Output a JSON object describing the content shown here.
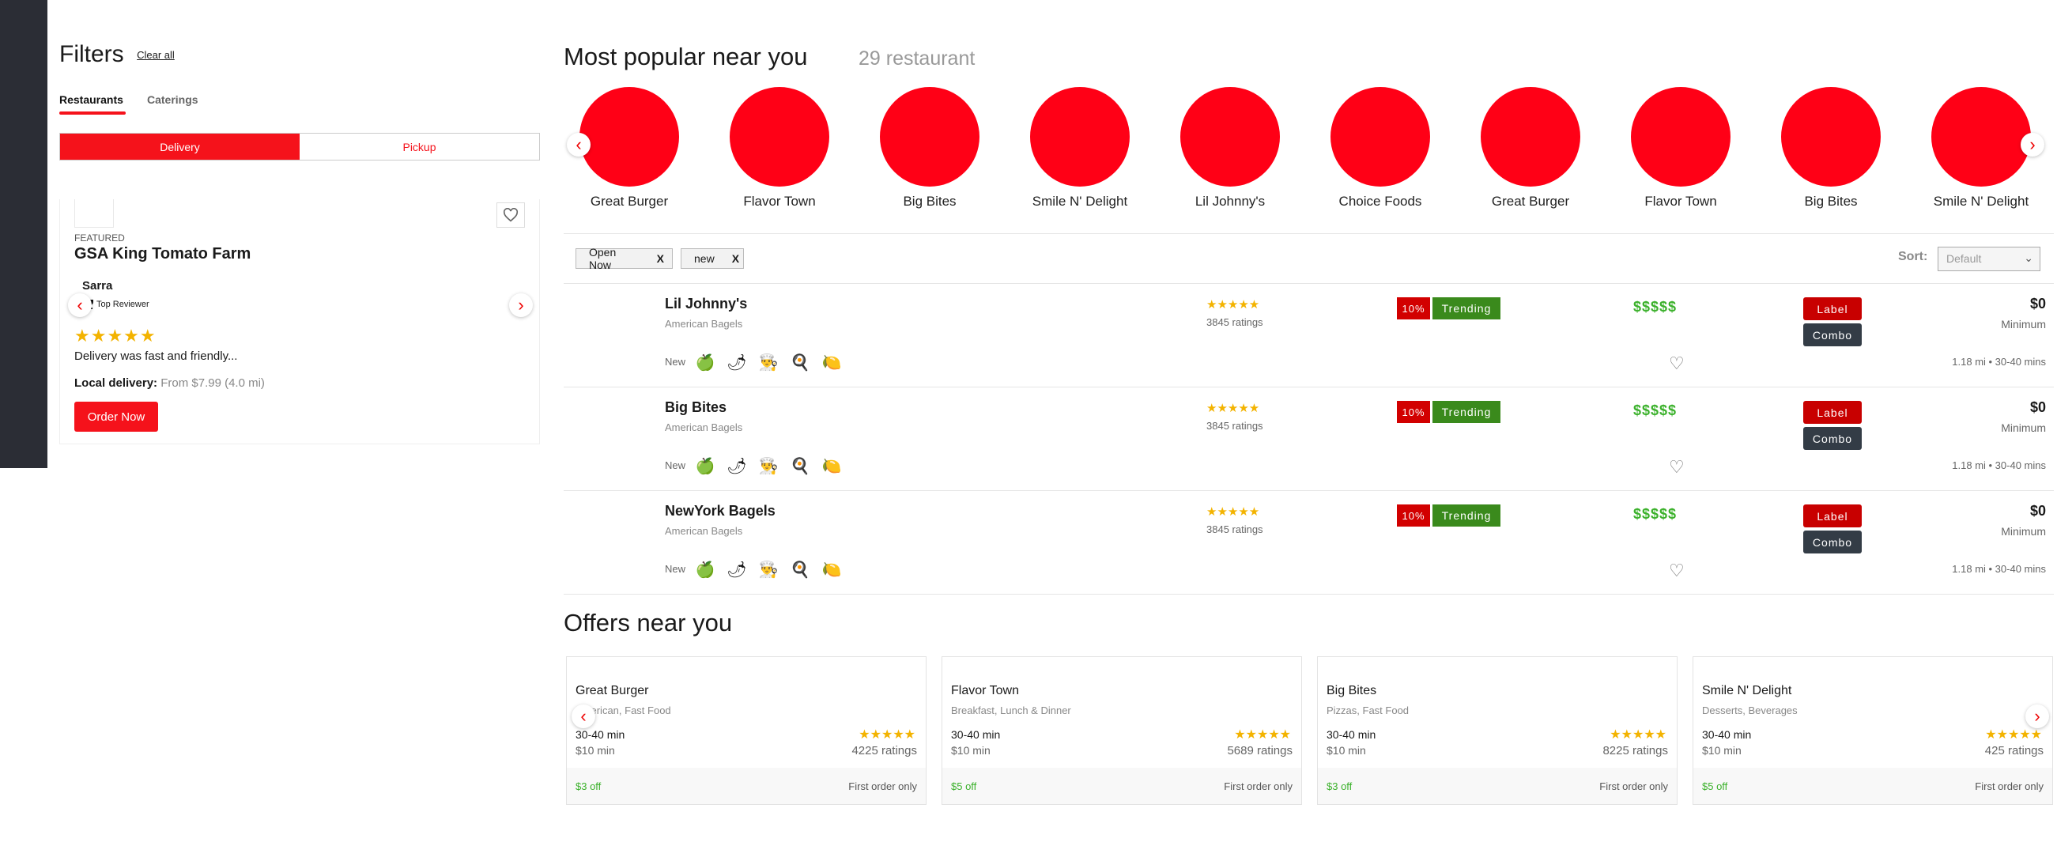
{
  "filters": {
    "title": "Filters",
    "clear": "Clear all",
    "tabs": [
      "Restaurants",
      "Caterings"
    ],
    "toggle": [
      "Delivery",
      "Pickup"
    ]
  },
  "review": {
    "featured": "FEATURED",
    "name": "GSA King Tomato Farm",
    "user": "Sarra",
    "badge": "Top Reviewer",
    "stars": "★★★★★",
    "text": "Delivery was fast and friendly...",
    "delivery_label": "Local delivery:",
    "delivery_value": "From $7.99 (4.0 mi)",
    "order": "Order Now"
  },
  "popular": {
    "title": "Most popular near you",
    "count": "29 restaurant",
    "items": [
      "Great Burger",
      "Flavor Town",
      "Big Bites",
      "Smile N' Delight",
      "Lil Johnny's",
      "Choice Foods",
      "Great Burger",
      "Flavor Town",
      "Big Bites",
      "Smile N' Delight"
    ]
  },
  "chips": [
    "Open Now",
    "new"
  ],
  "sort": {
    "label": "Sort:",
    "value": "Default"
  },
  "restaurants": [
    {
      "name": "Lil Johnny's",
      "cuisine": "American Bagels",
      "new": "New",
      "stars": "★★★★★",
      "ratings": "3845 ratings",
      "discount": "10%",
      "trend": "Trending",
      "price": "$$$$$",
      "label": "Label",
      "combo": "Combo",
      "fee": "$0",
      "min": "Minimum",
      "dist": "1.18 mi  •  30-40 mins"
    },
    {
      "name": "Big Bites",
      "cuisine": "American Bagels",
      "new": "New",
      "stars": "★★★★★",
      "ratings": "3845 ratings",
      "discount": "10%",
      "trend": "Trending",
      "price": "$$$$$",
      "label": "Label",
      "combo": "Combo",
      "fee": "$0",
      "min": "Minimum",
      "dist": "1.18 mi  •  30-40 mins"
    },
    {
      "name": "NewYork Bagels",
      "cuisine": "American Bagels",
      "new": "New",
      "stars": "★★★★★",
      "ratings": "3845 ratings",
      "discount": "10%",
      "trend": "Trending",
      "price": "$$$$$",
      "label": "Label",
      "combo": "Combo",
      "fee": "$0",
      "min": "Minimum",
      "dist": "1.18 mi  •  30-40 mins"
    }
  ],
  "offers": {
    "title": "Offers near you",
    "items": [
      {
        "name": "Great Burger",
        "cuisine": "American, Fast Food",
        "time": "30-40 min",
        "min": "$10 min",
        "stars": "★★★★★",
        "ratings": "4225 ratings",
        "discount": "$3 off",
        "first": "First order only"
      },
      {
        "name": "Flavor Town",
        "cuisine": "Breakfast, Lunch & Dinner",
        "time": "30-40 min",
        "min": "$10 min",
        "stars": "★★★★★",
        "ratings": "5689 ratings",
        "discount": "$5 off",
        "first": "First order only"
      },
      {
        "name": "Big Bites",
        "cuisine": "Pizzas, Fast Food",
        "time": "30-40 min",
        "min": "$10 min",
        "stars": "★★★★★",
        "ratings": "8225 ratings",
        "discount": "$3 off",
        "first": "First order only"
      },
      {
        "name": "Smile N' Delight",
        "cuisine": "Desserts, Beverages",
        "time": "30-40 min",
        "min": "$10 min",
        "stars": "★★★★★",
        "ratings": "425 ratings",
        "discount": "$5 off",
        "first": "First order only"
      }
    ]
  },
  "icons": [
    "lime-icon",
    "chili-icon",
    "chef-hat-icon",
    "fried-egg-icon",
    "lemon-icon"
  ],
  "colors": {
    "accent": "#f5121b",
    "trending": "#3a8a1c",
    "price": "#3bb12b",
    "star": "#f3b300",
    "sidebar": "#2b2d35"
  }
}
